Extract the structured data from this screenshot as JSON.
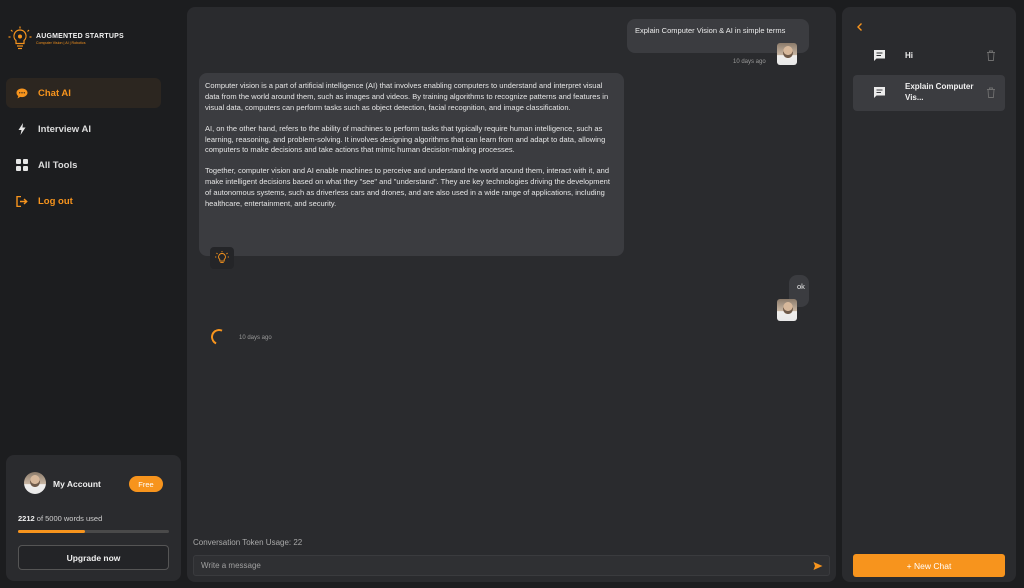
{
  "brand": {
    "title": "AUGMENTED STARTUPS",
    "subtitle": "Computer Vision | AI | Robotics"
  },
  "nav": {
    "items": [
      {
        "label": "Chat AI",
        "icon": "chat-bubble-icon"
      },
      {
        "label": "Interview AI",
        "icon": "lightning-icon"
      },
      {
        "label": "All Tools",
        "icon": "grid-icon"
      },
      {
        "label": "Log out",
        "icon": "logout-icon"
      }
    ]
  },
  "account": {
    "label": "My Account",
    "plan_badge": "Free",
    "words_used": "2212",
    "usage_suffix": "of 5000 words used",
    "usage_fraction": 0.4424,
    "upgrade_label": "Upgrade now"
  },
  "chat": {
    "messages": [
      {
        "role": "user",
        "text": "Explain Computer Vision & AI in simple terms",
        "time": "10 days ago"
      },
      {
        "role": "assistant",
        "paragraphs": [
          "Computer vision is a part of artificial intelligence (AI) that involves enabling computers to understand and interpret visual data from the world around them, such as images and videos. By training algorithms to recognize patterns and features in visual data, computers can perform tasks such as object detection, facial recognition, and image classification.",
          "AI, on the other hand, refers to the ability of machines to perform tasks that typically require human intelligence, such as learning, reasoning, and problem-solving. It involves designing algorithms that can learn from and adapt to data, allowing computers to make decisions and take actions that mimic human decision-making processes.",
          "Together, computer vision and AI enable machines to perceive and understand the world around them, interact with it, and make intelligent decisions based on what they \"see\" and \"understand\". They are key technologies driving the development of autonomous systems, such as driverless cars and drones, and are also used in a wide range of applications, including healthcare, entertainment, and security."
        ]
      },
      {
        "role": "user",
        "text": "ok"
      },
      {
        "role": "assistant",
        "loading": true,
        "time": "10 days ago"
      }
    ],
    "token_usage": "Conversation Token Usage: 22",
    "input_placeholder": "Write a message"
  },
  "history": {
    "conversations": [
      {
        "title": "Hi",
        "active": false
      },
      {
        "title": "Explain Computer Vis...",
        "active": true
      }
    ],
    "new_chat_label": "+ New Chat"
  },
  "colors": {
    "accent": "#f7941d",
    "background": "#1c1d1f",
    "panel": "#2a2b2e",
    "bubble": "#3b3c40"
  }
}
